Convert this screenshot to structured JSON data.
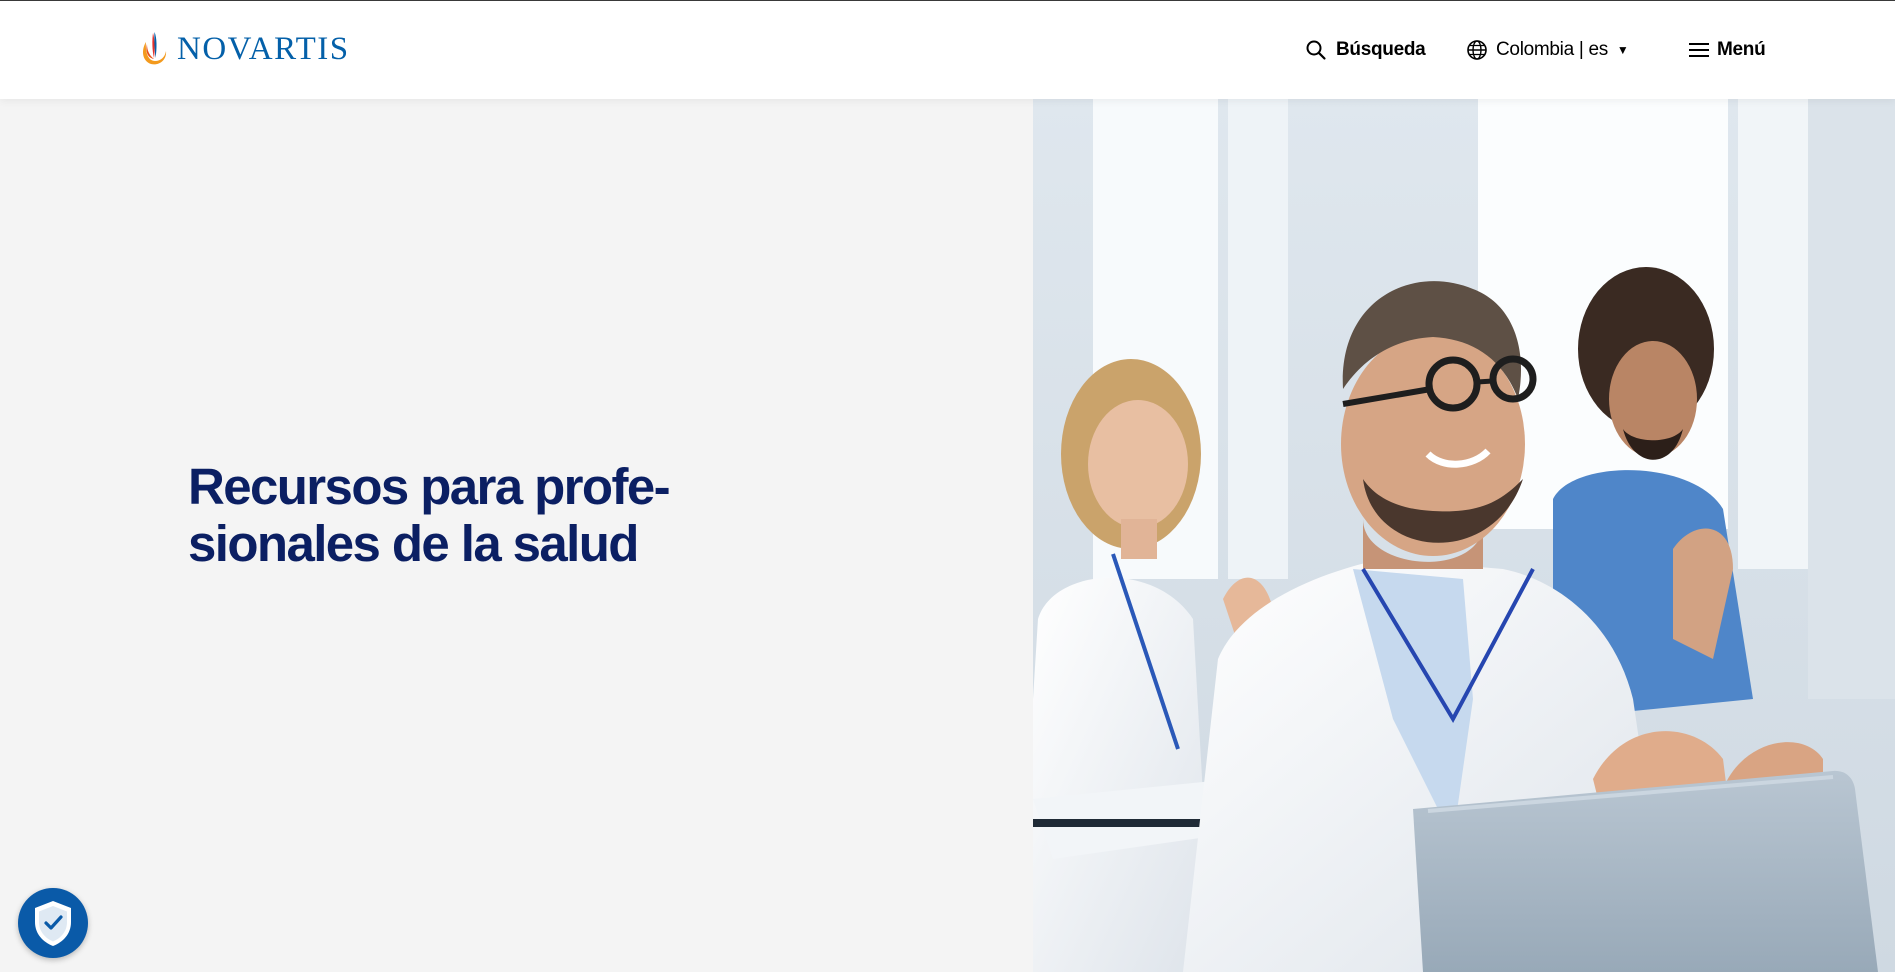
{
  "header": {
    "logo_text": "NOVARTIS",
    "search_label": "Búsqueda",
    "country_label": "Colombia | es",
    "menu_label": "Menú",
    "icons": [
      "novartis-flame-icon",
      "search-icon",
      "globe-icon",
      "caret-down-icon",
      "hamburger-icon"
    ]
  },
  "hero": {
    "title_line1": "Recursos para profe-",
    "title_line2": "sionales de la salud",
    "image_subject": "healthcare-professionals-applauding-photo"
  },
  "cookie_badge": {
    "icon": "shield-check-icon"
  },
  "colors": {
    "brand_blue": "#0460a9",
    "title_navy": "#0b1f63",
    "panel_gray": "#f4f4f4",
    "badge_blue": "#0a5aa8"
  }
}
